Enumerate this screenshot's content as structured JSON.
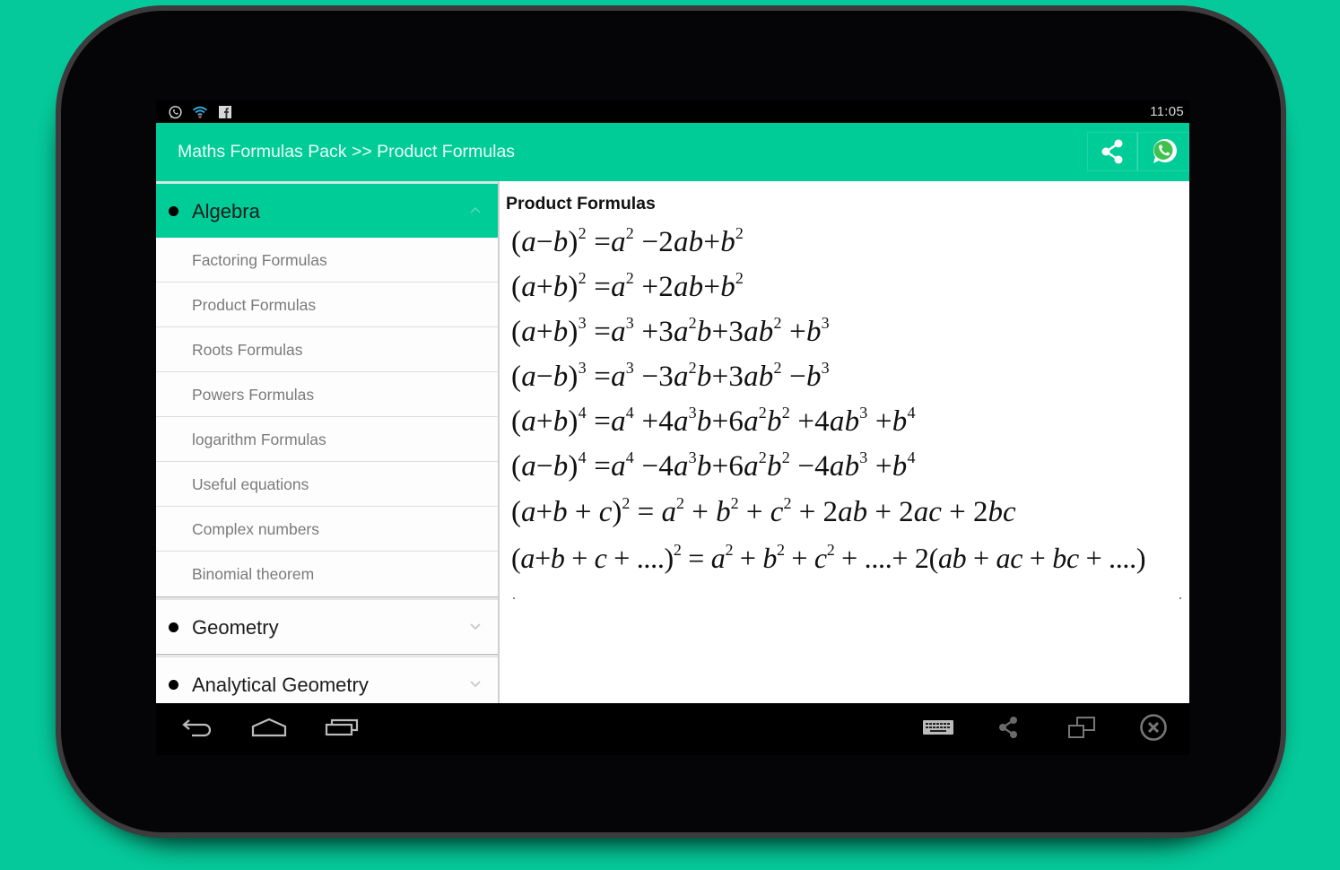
{
  "colors": {
    "background": "#05c99a",
    "accent": "#00cc98",
    "device": "#050406"
  },
  "statusbar": {
    "notification_icons": [
      "whatsapp-icon",
      "wifi-icon",
      "facebook-icon"
    ],
    "time": "11:05"
  },
  "actionbar": {
    "title": "Maths Formulas Pack >> Product Formulas",
    "actions": [
      {
        "name": "share",
        "icon": "share-icon"
      },
      {
        "name": "whatsapp-share",
        "icon": "whatsapp-icon"
      }
    ]
  },
  "sidebar": {
    "groups": [
      {
        "label": "Algebra",
        "expanded": true,
        "children": [
          "Factoring Formulas",
          "Product Formulas",
          "Roots Formulas",
          "Powers Formulas",
          "logarithm Formulas",
          "Useful equations",
          "Complex numbers",
          "Binomial theorem"
        ]
      },
      {
        "label": "Geometry",
        "expanded": false,
        "children": []
      },
      {
        "label": "Analytical Geometry",
        "expanded": false,
        "children": []
      }
    ]
  },
  "main": {
    "title": "Product Formulas",
    "formulas": [
      "(a−b)² = a² − 2ab + b²",
      "(a+b)² = a² + 2ab + b²",
      "(a+b)³ = a³ + 3a²b + 3ab² + b³",
      "(a−b)³ = a³ − 3a²b + 3ab² − b³",
      "(a+b)⁴ = a⁴ + 4a³b + 6a²b² + 4ab³ + b⁴",
      "(a−b)⁴ = a⁴ − 4a³b + 6a²b² − 4ab³ + b⁴",
      "(a+b+c)² = a² + b² + c² + 2ab + 2ac + 2bc",
      "(a+b+c+....)² = a² + b² + c² + .... + 2(ab + ac + bc + ....)"
    ]
  },
  "navbar": {
    "left": [
      "back-icon",
      "home-icon",
      "recent-apps-icon"
    ],
    "right": [
      "keyboard-icon",
      "share-icon",
      "window-resize-icon",
      "close-icon"
    ]
  }
}
